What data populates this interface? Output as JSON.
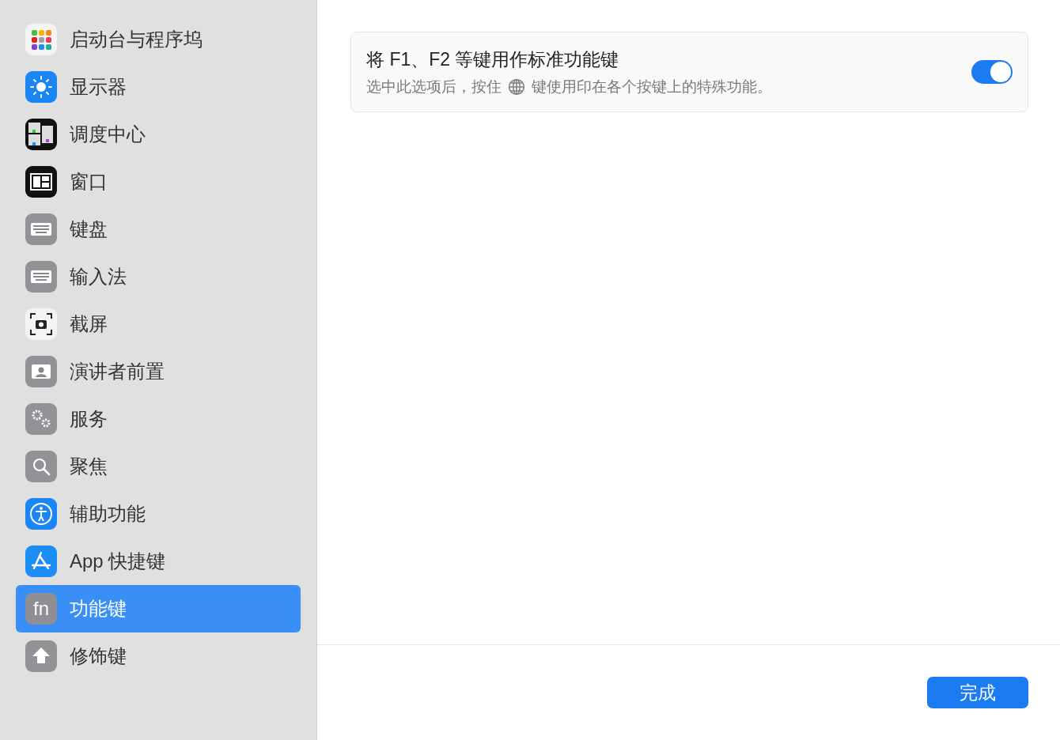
{
  "sidebar": {
    "items": [
      {
        "label": "启动台与程序坞",
        "selected": false
      },
      {
        "label": "显示器",
        "selected": false
      },
      {
        "label": "调度中心",
        "selected": false
      },
      {
        "label": "窗口",
        "selected": false
      },
      {
        "label": "键盘",
        "selected": false
      },
      {
        "label": "输入法",
        "selected": false
      },
      {
        "label": "截屏",
        "selected": false
      },
      {
        "label": "演讲者前置",
        "selected": false
      },
      {
        "label": "服务",
        "selected": false
      },
      {
        "label": "聚焦",
        "selected": false
      },
      {
        "label": "辅助功能",
        "selected": false
      },
      {
        "label": "App 快捷键",
        "selected": false
      },
      {
        "label": "功能键",
        "icon_text": "fn",
        "selected": true
      },
      {
        "label": "修饰键",
        "selected": false
      }
    ]
  },
  "setting": {
    "title": "将 F1、F2 等键用作标准功能键",
    "description_before": "选中此选项后，按住",
    "description_after": "键使用印在各个按键上的特殊功能。",
    "on": true
  },
  "buttons": [
    {
      "label": "完成"
    }
  ]
}
